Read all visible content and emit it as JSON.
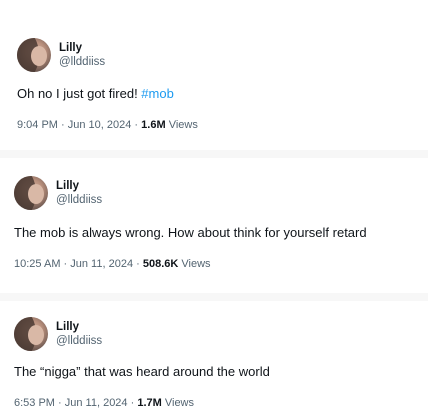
{
  "tweets": [
    {
      "display_name": "Lilly",
      "handle": "@llddiiss",
      "text": "Oh no I just got fired! ",
      "hashtag": "#mob",
      "time": "9:04 PM",
      "date": "Jun 10, 2024",
      "views_count": "1.6M",
      "views_label": "Views"
    },
    {
      "display_name": "Lilly",
      "handle": "@llddiiss",
      "text": "The mob is always wrong. How about think for yourself retard",
      "time": "10:25 AM",
      "date": "Jun 11, 2024",
      "views_count": "508.6K",
      "views_label": "Views"
    },
    {
      "display_name": "Lilly",
      "handle": "@llddiiss",
      "text": "The “nigga” that was heard around the world",
      "time": "6:53 PM",
      "date": "Jun 11, 2024",
      "views_count": "1.7M",
      "views_label": "Views"
    }
  ],
  "separator": " · "
}
